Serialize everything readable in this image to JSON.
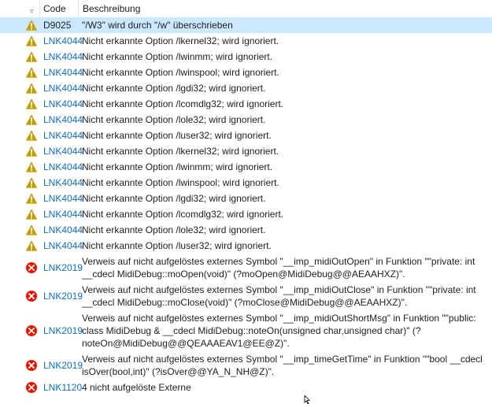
{
  "header": {
    "code": "Code",
    "description": "Beschreibung"
  },
  "rows": [
    {
      "type": "warning",
      "code": "D9025",
      "desc": "\"/W3\" wird durch \"/w\" überschrieben",
      "selected": true
    },
    {
      "type": "warning",
      "code": "LNK4044",
      "desc": "Nicht erkannte Option /lkernel32; wird ignoriert."
    },
    {
      "type": "warning",
      "code": "LNK4044",
      "desc": "Nicht erkannte Option /lwinmm; wird ignoriert."
    },
    {
      "type": "warning",
      "code": "LNK4044",
      "desc": "Nicht erkannte Option /lwinspool; wird ignoriert."
    },
    {
      "type": "warning",
      "code": "LNK4044",
      "desc": "Nicht erkannte Option /lgdi32; wird ignoriert."
    },
    {
      "type": "warning",
      "code": "LNK4044",
      "desc": "Nicht erkannte Option /lcomdlg32; wird ignoriert."
    },
    {
      "type": "warning",
      "code": "LNK4044",
      "desc": "Nicht erkannte Option /lole32; wird ignoriert."
    },
    {
      "type": "warning",
      "code": "LNK4044",
      "desc": "Nicht erkannte Option /luser32; wird ignoriert."
    },
    {
      "type": "warning",
      "code": "LNK4044",
      "desc": "Nicht erkannte Option /lkernel32; wird ignoriert."
    },
    {
      "type": "warning",
      "code": "LNK4044",
      "desc": "Nicht erkannte Option /lwinmm; wird ignoriert."
    },
    {
      "type": "warning",
      "code": "LNK4044",
      "desc": "Nicht erkannte Option /lwinspool; wird ignoriert."
    },
    {
      "type": "warning",
      "code": "LNK4044",
      "desc": "Nicht erkannte Option /lgdi32; wird ignoriert."
    },
    {
      "type": "warning",
      "code": "LNK4044",
      "desc": "Nicht erkannte Option /lcomdlg32; wird ignoriert."
    },
    {
      "type": "warning",
      "code": "LNK4044",
      "desc": "Nicht erkannte Option /lole32; wird ignoriert."
    },
    {
      "type": "warning",
      "code": "LNK4044",
      "desc": "Nicht erkannte Option /luser32; wird ignoriert."
    },
    {
      "type": "error",
      "code": "LNK2019",
      "desc": "Verweis auf nicht aufgelöstes externes Symbol \"__imp_midiOutOpen\" in Funktion \"\"private: int\n__cdecl MidiDebug::moOpen(void)\" (?moOpen@MidiDebug@@AEAAHXZ)\"."
    },
    {
      "type": "error",
      "code": "LNK2019",
      "desc": "Verweis auf nicht aufgelöstes externes Symbol \"__imp_midiOutClose\" in Funktion \"\"private: int\n__cdecl MidiDebug::moClose(void)\" (?moClose@MidiDebug@@AEAAHXZ)\"."
    },
    {
      "type": "error",
      "code": "LNK2019",
      "desc": "Verweis auf nicht aufgelöstes externes Symbol \"__imp_midiOutShortMsg\" in Funktion \"\"public:\nclass MidiDebug & __cdecl MidiDebug::noteOn(unsigned char,unsigned char)\" (?\nnoteOn@MidiDebug@@QEAAAEAV1@EE@Z)\"."
    },
    {
      "type": "error",
      "code": "LNK2019",
      "desc": "Verweis auf nicht aufgelöstes externes Symbol \"__imp_timeGetTime\" in Funktion \"\"bool __cdecl\nisOver(bool,int)\" (?isOver@@YA_N_NH@Z)\"."
    },
    {
      "type": "error",
      "code": "LNK1120",
      "desc": "4 nicht aufgelöste Externe"
    }
  ],
  "colors": {
    "warning": "#c59d00",
    "error": "#e51400",
    "link": "#0e70c0",
    "selected": "#cce8ff"
  },
  "icons": {
    "warning": "warning-icon",
    "error": "error-icon",
    "sort": "sort-icon",
    "cursor": "mouse-cursor"
  }
}
